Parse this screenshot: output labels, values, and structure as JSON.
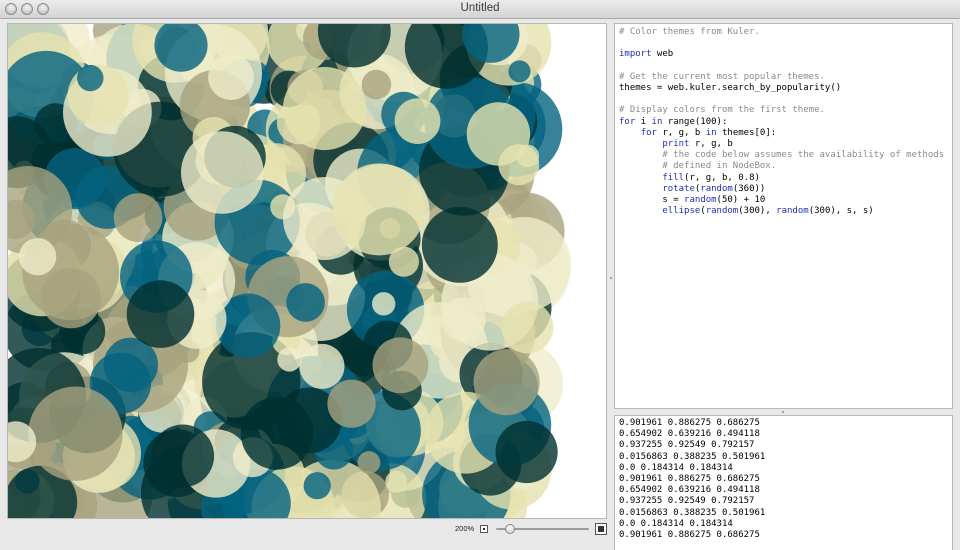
{
  "window": {
    "title": "Untitled"
  },
  "colors": {
    "theme": [
      "#e6e2af",
      "#a7a37e",
      "#efecca",
      "#046380",
      "#002f2f"
    ],
    "comment": "#8a8a8a",
    "keyword": "#1f2fb4"
  },
  "icons": [
    "close-icon",
    "minimize-icon",
    "zoom-icon",
    "zoom-out-icon",
    "zoom-in-icon"
  ],
  "canvas": {
    "fill_alpha": 0.8
  },
  "zoom": {
    "label": "200%",
    "level": 0.15
  },
  "code": {
    "lines": [
      [
        {
          "t": "# Color themes from Kuler.",
          "c": "comment"
        }
      ],
      [],
      [
        {
          "t": "import",
          "c": "kw"
        },
        {
          "t": " web",
          "c": "plain"
        }
      ],
      [],
      [
        {
          "t": "# Get the current most popular themes.",
          "c": "comment"
        }
      ],
      [
        {
          "t": "themes = web.kuler.search_by_popularity()",
          "c": "plain"
        }
      ],
      [],
      [
        {
          "t": "# Display colors from the first theme.",
          "c": "comment"
        }
      ],
      [
        {
          "t": "for",
          "c": "kw"
        },
        {
          "t": " i ",
          "c": "plain"
        },
        {
          "t": "in",
          "c": "kw"
        },
        {
          "t": " range(100):",
          "c": "plain"
        }
      ],
      [
        {
          "t": "    ",
          "c": "plain"
        },
        {
          "t": "for",
          "c": "kw"
        },
        {
          "t": " r, g, b ",
          "c": "plain"
        },
        {
          "t": "in",
          "c": "kw"
        },
        {
          "t": " themes[0]:",
          "c": "plain"
        }
      ],
      [
        {
          "t": "        ",
          "c": "plain"
        },
        {
          "t": "print",
          "c": "kw"
        },
        {
          "t": " r, g, b",
          "c": "plain"
        }
      ],
      [
        {
          "t": "        # the code below assumes the availability of methods",
          "c": "comment"
        }
      ],
      [
        {
          "t": "        # defined in NodeBox.",
          "c": "comment"
        }
      ],
      [
        {
          "t": "        ",
          "c": "plain"
        },
        {
          "t": "fill",
          "c": "kw"
        },
        {
          "t": "(r, g, b, 0.8)",
          "c": "plain"
        }
      ],
      [
        {
          "t": "        ",
          "c": "plain"
        },
        {
          "t": "rotate",
          "c": "kw"
        },
        {
          "t": "(",
          "c": "plain"
        },
        {
          "t": "random",
          "c": "kw"
        },
        {
          "t": "(360))",
          "c": "plain"
        }
      ],
      [
        {
          "t": "        s = ",
          "c": "plain"
        },
        {
          "t": "random",
          "c": "kw"
        },
        {
          "t": "(50) + 10",
          "c": "plain"
        }
      ],
      [
        {
          "t": "        ",
          "c": "plain"
        },
        {
          "t": "ellipse",
          "c": "kw"
        },
        {
          "t": "(",
          "c": "plain"
        },
        {
          "t": "random",
          "c": "kw"
        },
        {
          "t": "(300), ",
          "c": "plain"
        },
        {
          "t": "random",
          "c": "kw"
        },
        {
          "t": "(300), s, s)",
          "c": "plain"
        }
      ]
    ]
  },
  "output": {
    "lines": [
      "0.901961 0.886275 0.686275",
      "0.654902 0.639216 0.494118",
      "0.937255 0.92549 0.792157",
      "0.0156863 0.388235 0.501961",
      "0.0 0.184314 0.184314",
      "0.901961 0.886275 0.686275",
      "0.654902 0.639216 0.494118",
      "0.937255 0.92549 0.792157",
      "0.0156863 0.388235 0.501961",
      "0.0 0.184314 0.184314",
      "0.901961 0.886275 0.686275"
    ]
  }
}
